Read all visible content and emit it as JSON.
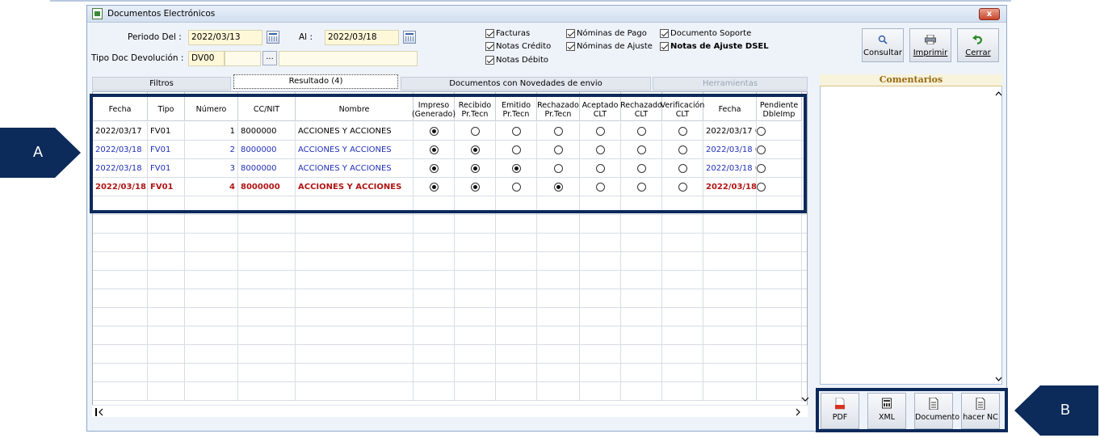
{
  "window": {
    "title": "Documentos Electrónicos",
    "close_label": "x"
  },
  "filters": {
    "periodo_label": "Periodo  Del :",
    "del_value": "2022/03/13",
    "al_label": "Al :",
    "al_value": "2022/03/18",
    "tipo_label": "Tipo Doc Devolución :",
    "tipo_value": "DV00",
    "browse_label": "..."
  },
  "checkboxes": [
    {
      "label": "Facturas",
      "checked": true
    },
    {
      "label": "Notas Crédito",
      "checked": true
    },
    {
      "label": "Notas Débito",
      "checked": true
    },
    {
      "label": "Nóminas de Pago",
      "checked": true
    },
    {
      "label": "Nóminas de Ajuste",
      "checked": true
    },
    {
      "label": "Documento Soporte",
      "checked": true
    },
    {
      "label": "Notas de Ajuste DSEL",
      "checked": true
    }
  ],
  "toolbar": {
    "consultar": "Consultar",
    "imprimir": "Imprimir",
    "cerrar": "Cerrar"
  },
  "tabs": [
    "Filtros",
    "Resultado (4)",
    "Documentos con Novedades de envio",
    "Herramientas"
  ],
  "grid": {
    "headers": [
      "Fecha",
      "Tipo",
      "Número",
      "CC/NIT",
      "Nombre",
      "Impreso\n(Generado)",
      "Recibido\nPr.Tecn",
      "Emitido\nPr.Tecn",
      "Rechazado\nPr.Tecn",
      "Aceptado\nCLT",
      "Rechazado\nCLT",
      "Verificación\nCLT",
      "Fecha",
      "Pendiente\nDbleImp"
    ],
    "rows": [
      {
        "fecha": "2022/03/17",
        "tipo": "FV01",
        "numero": "1",
        "nit": "8000000",
        "nombre": "ACCIONES Y ACCIONES",
        "radios": [
          true,
          false,
          false,
          false,
          false,
          false,
          false
        ],
        "fecha2": "2022/03/17 0",
        "pend": false,
        "style": "black"
      },
      {
        "fecha": "2022/03/18",
        "tipo": "FV01",
        "numero": "2",
        "nit": "8000000",
        "nombre": "ACCIONES Y ACCIONES",
        "radios": [
          true,
          true,
          false,
          false,
          false,
          false,
          false
        ],
        "fecha2": "2022/03/18 0(",
        "pend": false,
        "style": "blue"
      },
      {
        "fecha": "2022/03/18",
        "tipo": "FV01",
        "numero": "3",
        "nit": "8000000",
        "nombre": "ACCIONES Y ACCIONES",
        "radios": [
          true,
          true,
          true,
          false,
          false,
          false,
          false
        ],
        "fecha2": "2022/03/18 0(",
        "pend": false,
        "style": "blue"
      },
      {
        "fecha": "2022/03/18",
        "tipo": "FV01",
        "numero": "4",
        "nit": "8000000",
        "nombre": "ACCIONES Y ACCIONES",
        "radios": [
          true,
          true,
          false,
          true,
          false,
          false,
          false
        ],
        "fecha2": "2022/03/18",
        "pend": false,
        "style": "red"
      }
    ]
  },
  "comments": {
    "title": "Comentarios"
  },
  "bottom_buttons": [
    "PDF",
    "XML",
    "Documento",
    "hacer NC"
  ],
  "markers": {
    "a": "A",
    "b": "B"
  },
  "colors": {
    "accent_dark": "#0c2a5a",
    "row_blue": "#1f2fb5",
    "row_red": "#b01515"
  }
}
